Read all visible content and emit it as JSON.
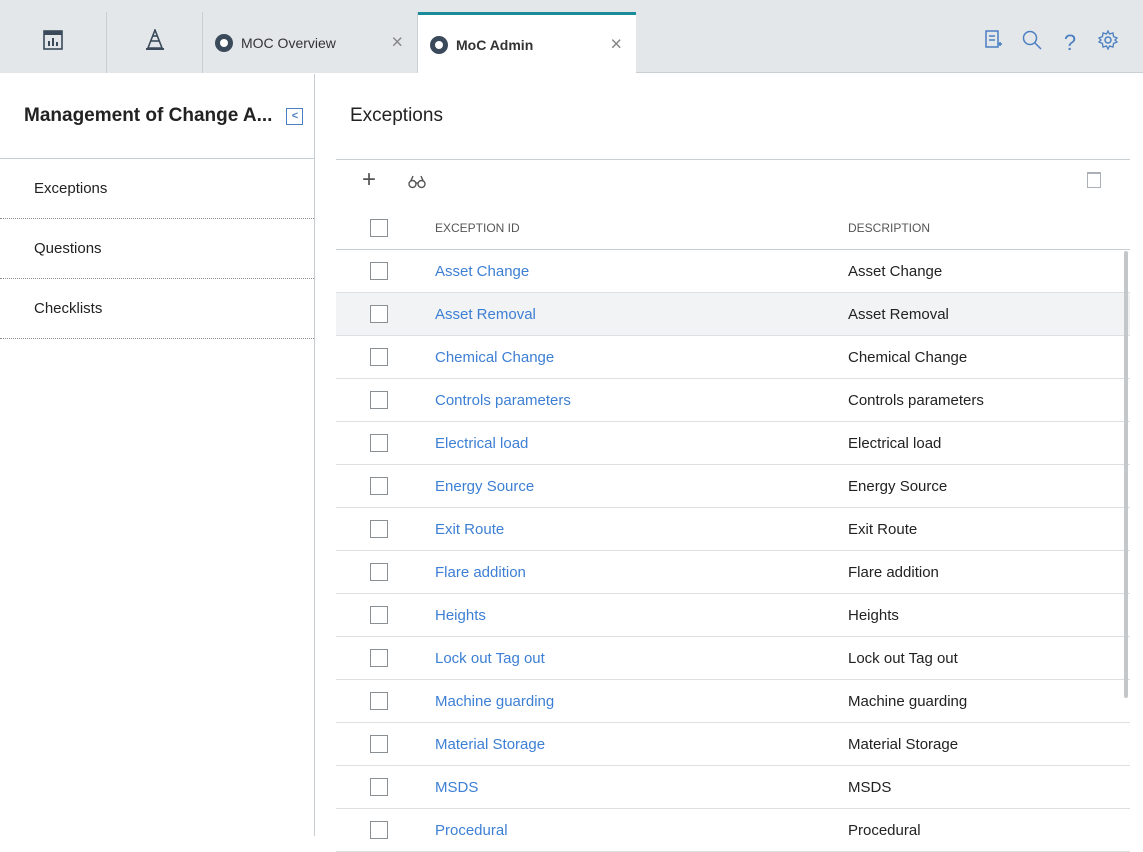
{
  "tabs": {
    "overview": {
      "label": "MOC Overview"
    },
    "admin": {
      "label": "MoC Admin"
    }
  },
  "toolbar": {
    "icons": [
      "dashboard-icon",
      "hierarchy-icon",
      "tasklist-icon",
      "search-icon",
      "help-icon",
      "settings-icon"
    ]
  },
  "sidebar": {
    "title": "Management of Change A...",
    "items": [
      {
        "label": "Exceptions"
      },
      {
        "label": "Questions"
      },
      {
        "label": "Checklists"
      }
    ]
  },
  "main": {
    "title": "Exceptions",
    "columns": {
      "id": "EXCEPTION ID",
      "description": "DESCRIPTION"
    },
    "rows": [
      {
        "id": "Asset Change",
        "description": "Asset Change"
      },
      {
        "id": "Asset Removal",
        "description": "Asset Removal"
      },
      {
        "id": "Chemical Change",
        "description": "Chemical Change"
      },
      {
        "id": "Controls parameters",
        "description": "Controls parameters"
      },
      {
        "id": "Electrical load",
        "description": "Electrical load"
      },
      {
        "id": "Energy Source",
        "description": "Energy Source"
      },
      {
        "id": "Exit Route",
        "description": "Exit Route"
      },
      {
        "id": "Flare addition",
        "description": "Flare addition"
      },
      {
        "id": "Heights",
        "description": "Heights"
      },
      {
        "id": "Lock out Tag out",
        "description": "Lock out Tag out"
      },
      {
        "id": "Machine guarding",
        "description": "Machine guarding"
      },
      {
        "id": "Material Storage",
        "description": "Material Storage"
      },
      {
        "id": "MSDS",
        "description": "MSDS"
      },
      {
        "id": "Procedural",
        "description": "Procedural"
      }
    ]
  },
  "colors": {
    "accent": "#1a8c99",
    "link": "#3d7fd4",
    "icon": "#4a7fc1"
  }
}
